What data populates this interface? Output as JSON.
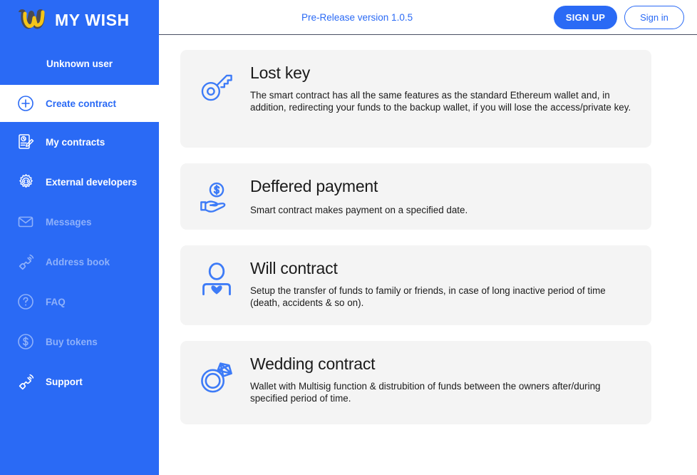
{
  "sidebar": {
    "brand_name": "MY WISH",
    "logo_icon": "mywish-w-logo",
    "username": "Unknown user",
    "items": [
      {
        "label": "Create contract",
        "icon": "plus-circle-icon",
        "state": "active"
      },
      {
        "label": "My contracts",
        "icon": "document-pencil-icon",
        "state": "enabled"
      },
      {
        "label": "External developers",
        "icon": "gear-code-icon",
        "state": "enabled"
      },
      {
        "label": "Messages",
        "icon": "envelope-icon",
        "state": "disabled"
      },
      {
        "label": "Address book",
        "icon": "phone-icon",
        "state": "disabled"
      },
      {
        "label": "FAQ",
        "icon": "question-circle-icon",
        "state": "disabled"
      },
      {
        "label": "Buy tokens",
        "icon": "dollar-circle-icon",
        "state": "disabled"
      },
      {
        "label": "Support",
        "icon": "phone-icon",
        "state": "enabled"
      }
    ]
  },
  "topbar": {
    "version_text": "Pre-Release version 1.0.5",
    "sign_up_label": "SIGN UP",
    "sign_in_label": "Sign in"
  },
  "cards": [
    {
      "icon": "key-icon",
      "title": "Lost key",
      "description": "The smart contract has all the same features as the standard Ethereum wallet and, in addition, redirecting your funds to the backup wallet, if you will lose the access/private key."
    },
    {
      "icon": "hand-dollar-icon",
      "title": "Deffered payment",
      "description": "Smart contract makes payment on a specified date."
    },
    {
      "icon": "person-heart-icon",
      "title": "Will contract",
      "description": "Setup the transfer of funds to family or friends, in case of long inactive period of time (death, accidents & so on)."
    },
    {
      "icon": "wedding-ring-icon",
      "title": "Wedding contract",
      "description": "Wallet with Multisig function & distrubition of funds between the owners after/during specified period of time."
    }
  ],
  "colors": {
    "sidebar_blue": "#2a6af5",
    "accent_blue": "#2a6af5",
    "icon_blue": "#3d7bf7",
    "card_bg": "#f4f4f4",
    "logo_yellow": "#f5c518",
    "logo_dark": "#4a4a52",
    "disabled_text": "#8fb1fa"
  }
}
